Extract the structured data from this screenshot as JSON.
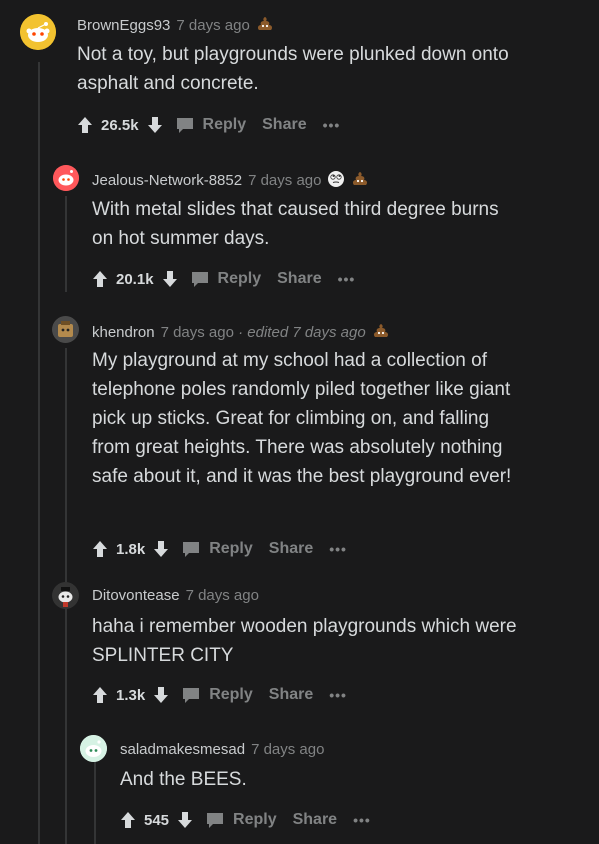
{
  "comments": [
    {
      "username": "BrownEggs93",
      "time": "7 days ago",
      "edited": "",
      "body": "Not a toy, but playgrounds were plunked down onto asphalt and concrete.",
      "score": "26.5k",
      "reply_label": "Reply",
      "share_label": "Share",
      "more_label": "•••",
      "avatar_icon": "snoo-avatar-icon",
      "awards": [
        "poop-award-icon"
      ]
    },
    {
      "username": "Jealous-Network-8852",
      "time": "7 days ago",
      "edited": "",
      "body": "With metal slides that caused third degree burns on hot summer days.",
      "score": "20.1k",
      "reply_label": "Reply",
      "share_label": "Share",
      "more_label": "•••",
      "avatar_icon": "snoo-avatar-icon",
      "awards": [
        "rolling-eyes-award-icon",
        "poop-award-icon"
      ]
    },
    {
      "username": "khendron",
      "time": "7 days ago",
      "edited": "· edited 7 days ago",
      "body": "My playground at my school had a collection of telephone poles randomly piled together like giant pick up sticks. Great for climbing on, and falling from great heights. There was absolutely nothing safe about it, and it was the best playground ever!",
      "score": "1.8k",
      "reply_label": "Reply",
      "share_label": "Share",
      "more_label": "•••",
      "avatar_icon": "snoo-avatar-icon",
      "awards": [
        "poop-award-icon"
      ]
    },
    {
      "username": "Ditovontease",
      "time": "7 days ago",
      "edited": "",
      "body": "haha i remember wooden playgrounds which were SPLINTER CITY",
      "score": "1.3k",
      "reply_label": "Reply",
      "share_label": "Share",
      "more_label": "•••",
      "avatar_icon": "snoo-avatar-icon",
      "awards": []
    },
    {
      "username": "saladmakesmesad",
      "time": "7 days ago",
      "edited": "",
      "body": "And the BEES.",
      "score": "545",
      "reply_label": "Reply",
      "share_label": "Share",
      "more_label": "•••",
      "avatar_icon": "snoo-avatar-icon",
      "awards": []
    }
  ],
  "colors": {
    "background": "#1a1a1b",
    "text": "#d7dadc",
    "muted": "#818384",
    "thread_line": "#343536"
  }
}
